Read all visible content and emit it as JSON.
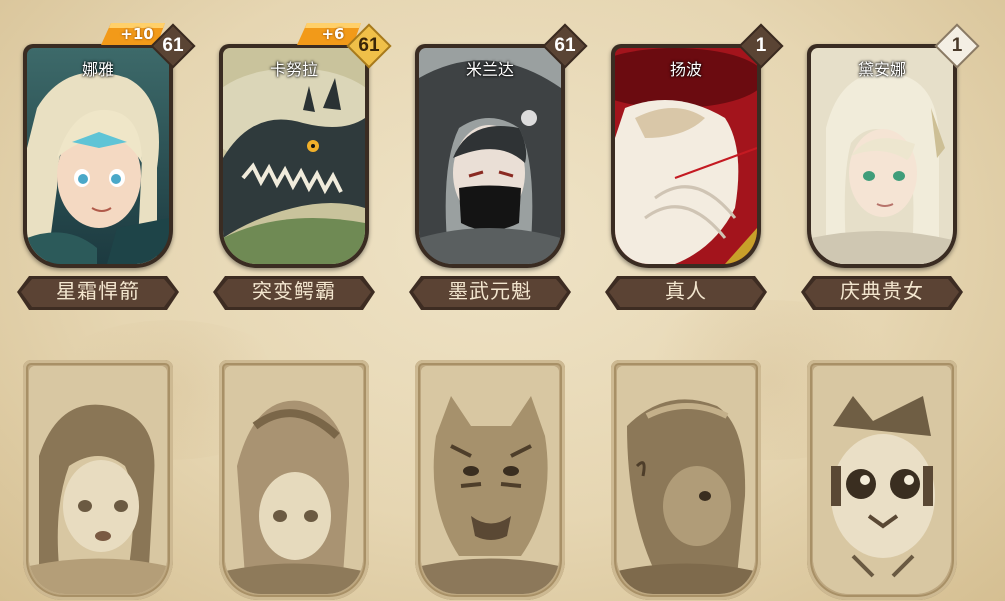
{
  "colors": {
    "plate": "#5b4334",
    "plate_edge": "#3d2c22",
    "badge_dark": "#5a4434",
    "badge_gold": "#f0c049",
    "badge_white": "#f4efe4",
    "bonus": "#f29a19"
  },
  "owned_heroes": [
    {
      "name": "娜雅",
      "title": "星霜悍箭",
      "level": "61",
      "badge_style": "dark",
      "bonus": "+10",
      "art_icon": "frost-archer-portrait"
    },
    {
      "name": "卡努拉",
      "title": "突变鳄霸",
      "level": "61",
      "badge_style": "gold",
      "bonus": "+6",
      "art_icon": "crocodile-portrait"
    },
    {
      "name": "米兰达",
      "title": "墨武元魁",
      "level": "61",
      "badge_style": "dark",
      "bonus": "",
      "art_icon": "masked-warrior-portrait"
    },
    {
      "name": "扬波",
      "title": "真人",
      "level": "1",
      "badge_style": "dark",
      "bonus": "",
      "art_icon": "white-beast-portrait"
    },
    {
      "name": "黛安娜",
      "title": "庆典贵女",
      "level": "1",
      "badge_style": "white",
      "bonus": "",
      "art_icon": "elf-lady-portrait"
    }
  ],
  "locked_heroes": [
    {
      "art_icon": "locked-girl-portrait"
    },
    {
      "art_icon": "locked-laurel-girl-portrait"
    },
    {
      "art_icon": "locked-tiger-portrait"
    },
    {
      "art_icon": "locked-beast-portrait"
    },
    {
      "art_icon": "locked-owl-portrait"
    }
  ]
}
